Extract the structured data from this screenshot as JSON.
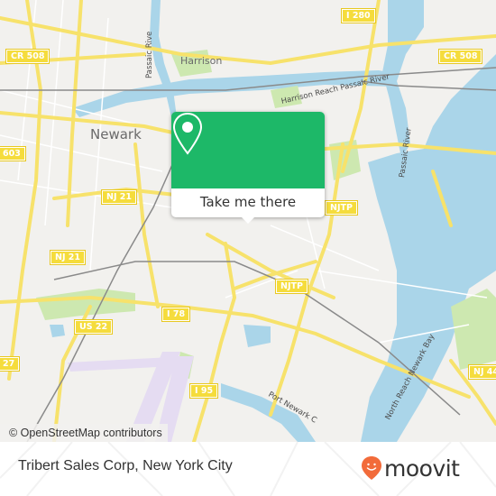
{
  "map": {
    "colors": {
      "land": "#f2f1ee",
      "water": "#aad5e9",
      "road_major": "#f7e26b",
      "road_minor": "#ffffff",
      "rail": "#888888",
      "park": "#cde8b0",
      "airport": "#e5dcf2"
    },
    "places": {
      "newark": "Newark",
      "harrison": "Harrison"
    },
    "water_labels": {
      "passaic_river_north": "Passaic Rive",
      "harrison_reach": "Harrison Reach Passaic River",
      "passaic_river_east": "Passaic River",
      "north_reach": "North Reach Newark Bay",
      "port_newark": "Port Newark C"
    },
    "shields": {
      "cr508_west": "CR 508",
      "cr508_east": "CR 508",
      "i280": "I 280",
      "r603": "603",
      "nj21_a": "NJ 21",
      "nj21_b": "NJ 21",
      "njtp_a": "NJTP",
      "njtp_b": "NJTP",
      "us22": "US 22",
      "i78": "I 78",
      "r27": "27",
      "i95": "I 95",
      "nj440": "NJ 44"
    },
    "attribution": "© OpenStreetMap contributors"
  },
  "popup": {
    "icon": "location-pin-icon",
    "accent": "#1db868",
    "button_label": "Take me there"
  },
  "footer": {
    "title": "Tribert Sales Corp, New York City",
    "logo_text": "moovit",
    "logo_accent": "#f26b3a"
  }
}
